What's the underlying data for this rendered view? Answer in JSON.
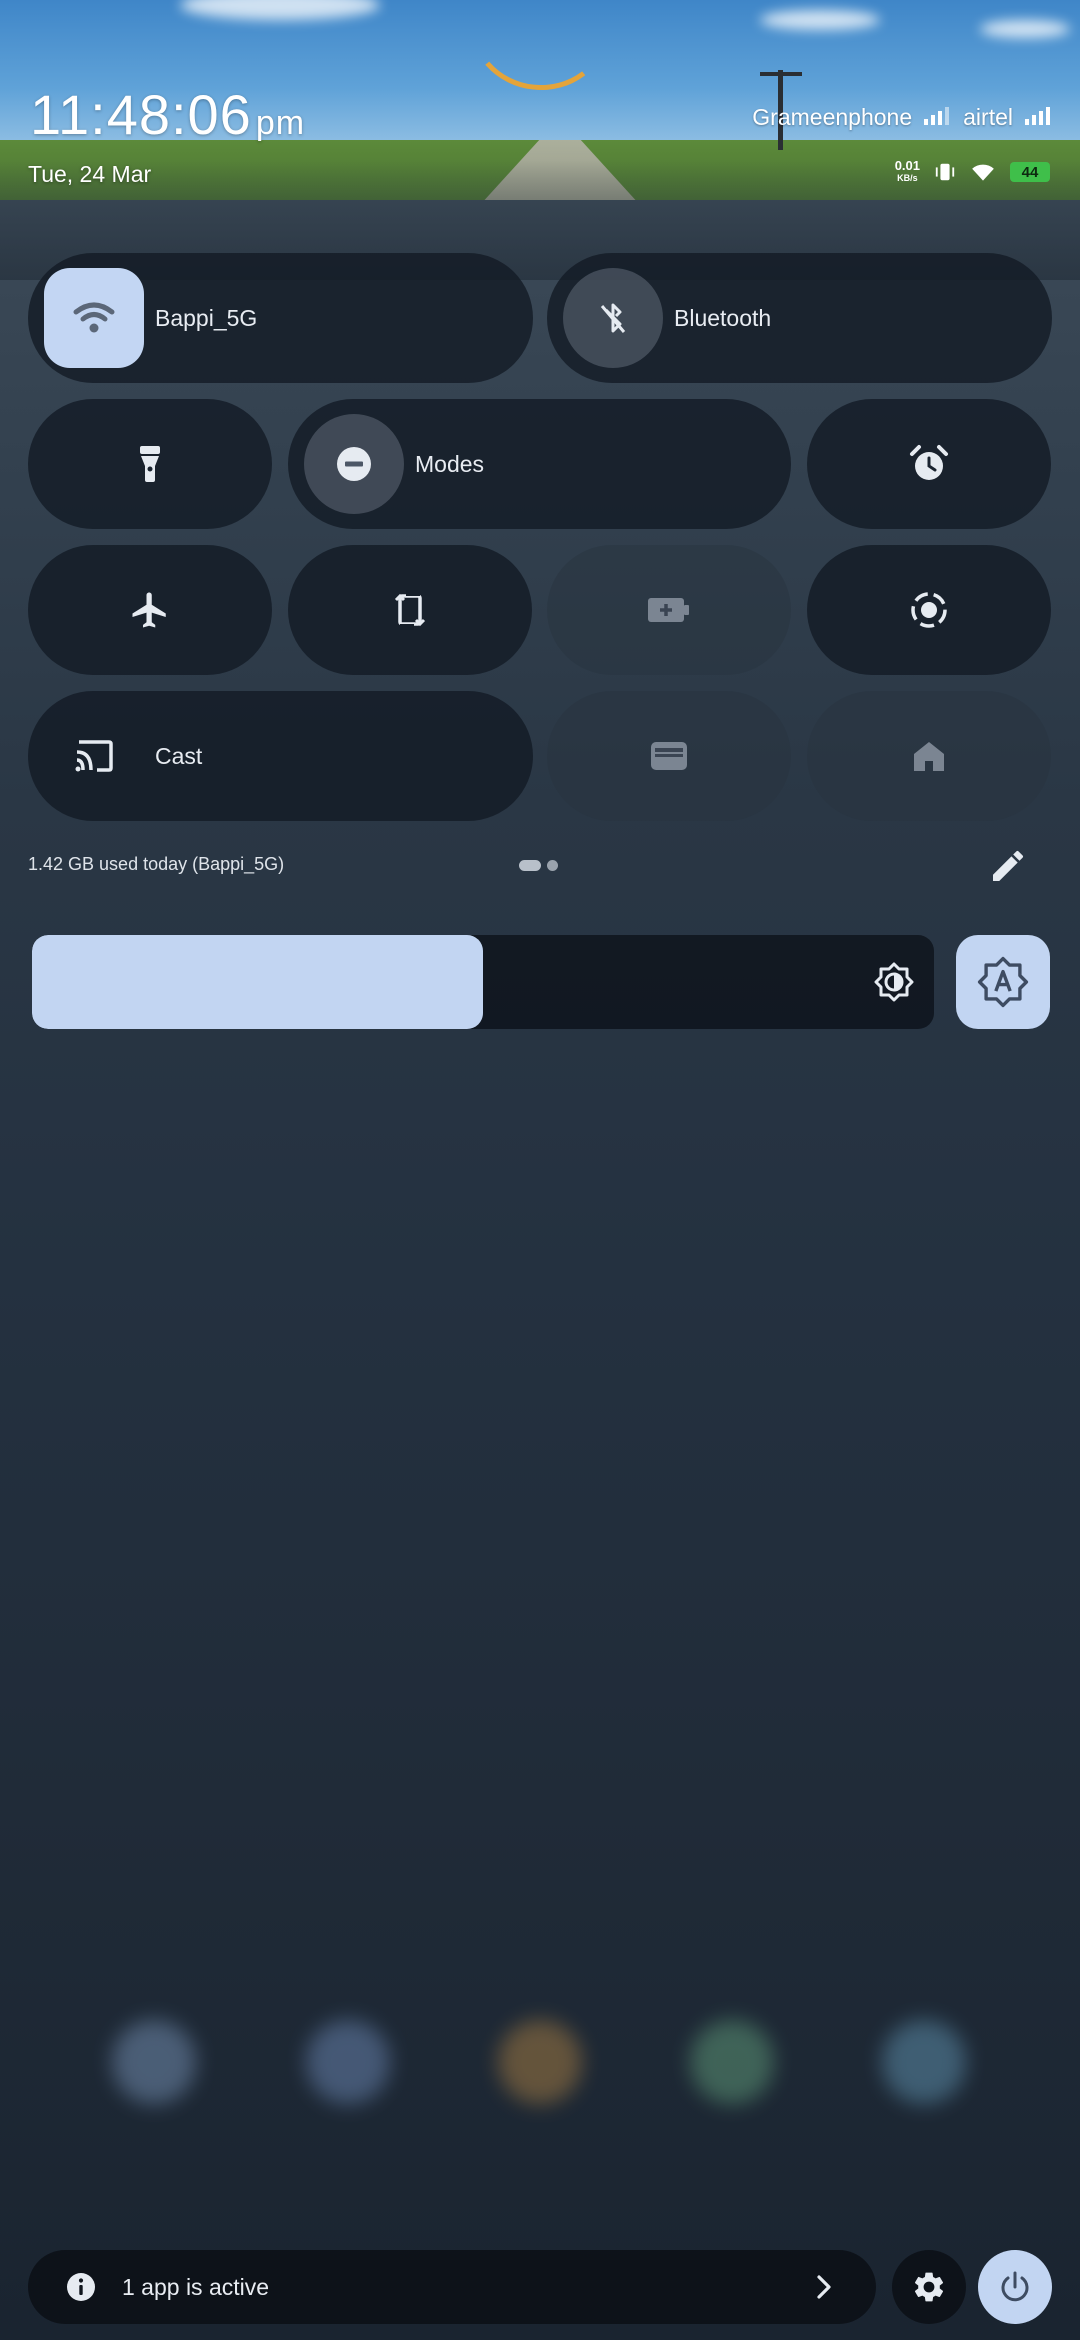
{
  "status": {
    "time": "11:48:06",
    "ampm": "pm",
    "date": "Tue, 24 Mar",
    "carrier1": "Grameenphone",
    "carrier2": "airtel",
    "net_speed_value": "0.01",
    "net_speed_unit": "KB/s",
    "battery_level": "44",
    "colors": {
      "battery": "#3fbf4a"
    }
  },
  "tiles": {
    "wifi": {
      "label": "Bappi_5G",
      "icon": "wifi-icon",
      "active": true
    },
    "bluetooth": {
      "label": "Bluetooth",
      "icon": "bluetooth-off-icon",
      "active": false
    },
    "flashlight": {
      "icon": "flashlight-icon"
    },
    "modes": {
      "label": "Modes",
      "icon": "do-not-disturb-icon"
    },
    "alarm": {
      "icon": "alarm-icon"
    },
    "airplane": {
      "icon": "airplane-icon"
    },
    "rotate": {
      "icon": "auto-rotate-icon"
    },
    "battery_saver": {
      "icon": "battery-saver-icon",
      "enabled": false
    },
    "screen_record": {
      "icon": "screen-record-icon"
    },
    "cast": {
      "label": "Cast",
      "icon": "cast-icon"
    },
    "wallet": {
      "icon": "wallet-icon",
      "enabled": false
    },
    "home": {
      "icon": "home-icon",
      "enabled": false
    }
  },
  "usage_text": "1.42 GB used today (Bappi_5G)",
  "pager": {
    "pages": 2,
    "current": 1
  },
  "brightness": {
    "level": 0.5,
    "icon": "brightness-icon",
    "auto_icon": "auto-brightness-icon",
    "accent": "#c2d5f2"
  },
  "footer": {
    "active_apps_text": "1 app is active",
    "info_icon": "info-icon",
    "chevron_icon": "chevron-right-icon",
    "settings_icon": "gear-icon",
    "power_icon": "power-icon"
  }
}
